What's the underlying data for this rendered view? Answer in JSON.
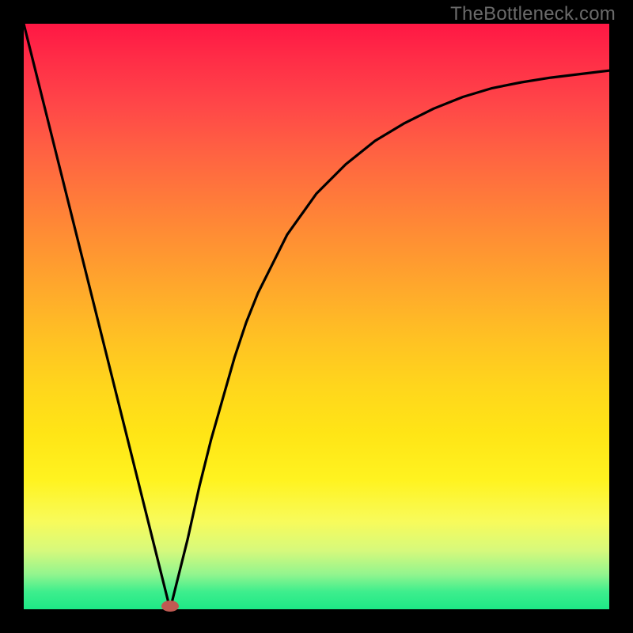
{
  "watermark": "TheBottleneck.com",
  "chart_data": {
    "type": "line",
    "title": "",
    "xlabel": "",
    "ylabel": "",
    "xlim": [
      0,
      100
    ],
    "ylim": [
      0,
      100
    ],
    "grid": false,
    "legend": false,
    "series": [
      {
        "name": "bottleneck-curve",
        "x": [
          0,
          2,
          4,
          6,
          8,
          10,
          12,
          14,
          16,
          18,
          20,
          22,
          24,
          25,
          26,
          28,
          30,
          32,
          34,
          36,
          38,
          40,
          42,
          45,
          50,
          55,
          60,
          65,
          70,
          75,
          80,
          85,
          90,
          95,
          100
        ],
        "y": [
          100,
          92,
          84,
          76,
          68,
          60,
          52,
          44,
          36,
          28,
          20,
          12,
          4,
          0,
          4,
          12,
          21,
          29,
          36,
          43,
          49,
          54,
          58,
          64,
          71,
          76,
          80,
          83,
          85.5,
          87.5,
          89,
          90,
          90.8,
          91.4,
          92
        ]
      }
    ],
    "min_point": {
      "x": 25,
      "y": 0
    },
    "gradient_meaning": "bottleneck severity (red=high, green=low)"
  }
}
